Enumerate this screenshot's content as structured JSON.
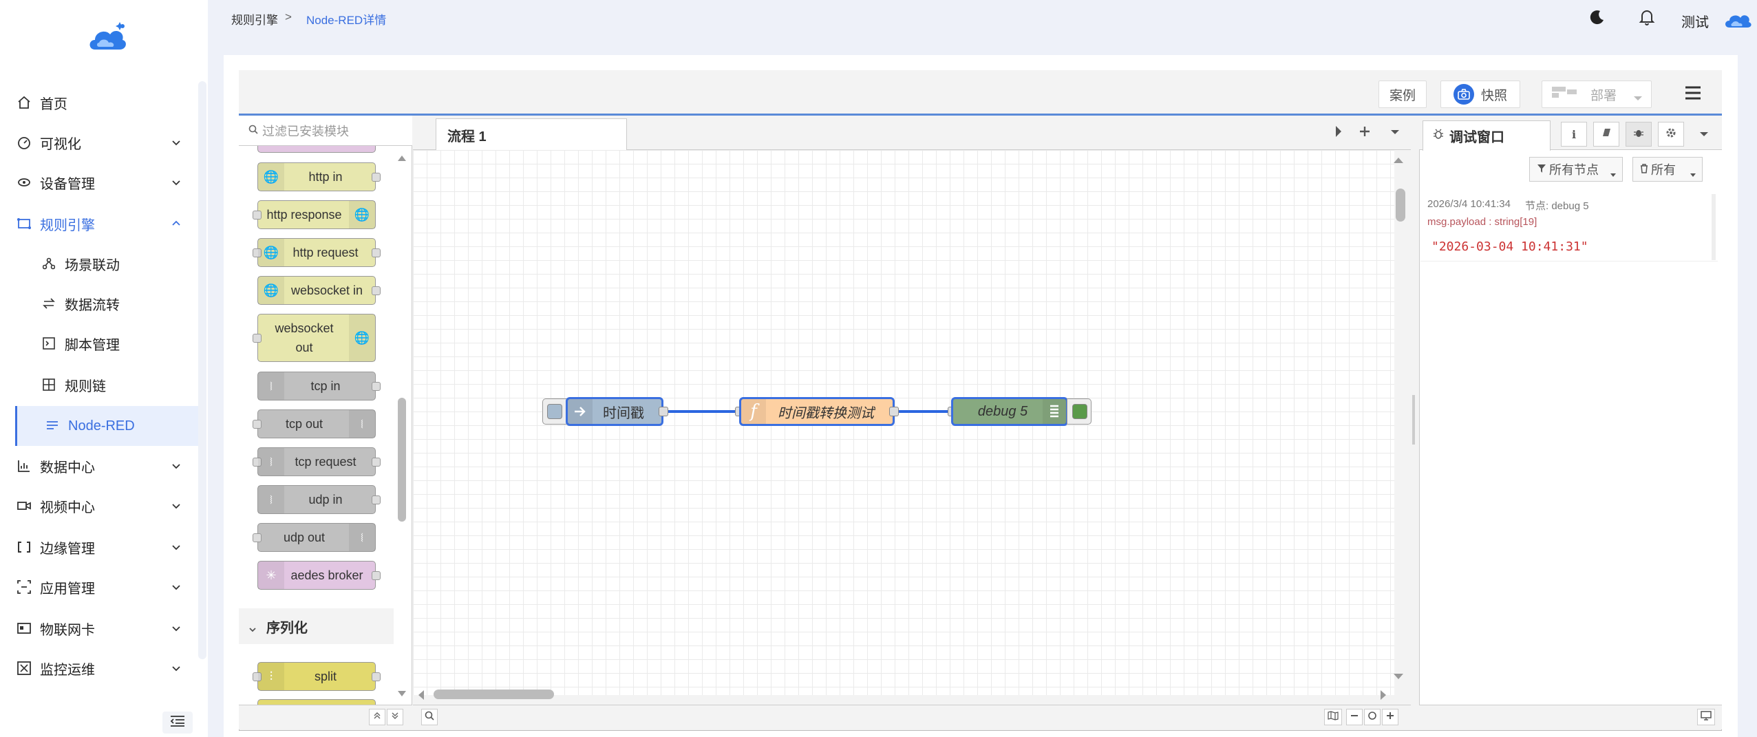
{
  "sidebar": {
    "items": [
      {
        "label": "首页",
        "icon": "home-icon"
      },
      {
        "label": "可视化",
        "icon": "dashboard-icon"
      },
      {
        "label": "设备管理",
        "icon": "device-icon"
      },
      {
        "label": "规则引擎",
        "icon": "rule-engine-icon"
      },
      {
        "label": "场景联动",
        "icon": "scene-icon"
      },
      {
        "label": "数据流转",
        "icon": "transfer-icon"
      },
      {
        "label": "脚本管理",
        "icon": "script-icon"
      },
      {
        "label": "规则链",
        "icon": "rule-chain-icon"
      },
      {
        "label": "Node-RED",
        "icon": "list-icon"
      },
      {
        "label": "数据中心",
        "icon": "chart-icon"
      },
      {
        "label": "视频中心",
        "icon": "video-icon"
      },
      {
        "label": "边缘管理",
        "icon": "edge-icon"
      },
      {
        "label": "应用管理",
        "icon": "app-icon"
      },
      {
        "label": "物联网卡",
        "icon": "card-icon"
      },
      {
        "label": "监控运维",
        "icon": "monitor-icon"
      }
    ]
  },
  "header": {
    "breadcrumb": [
      "规则引擎",
      "Node-RED详情"
    ],
    "separator": ">",
    "user": "测试"
  },
  "nodered": {
    "toolbar": {
      "cases": "案例",
      "snapshot": "快照",
      "deploy": "部署"
    },
    "palette": {
      "search_placeholder": "过滤已安装模块",
      "nodes": [
        "http in",
        "http response",
        "http request",
        "websocket in",
        "websocket out",
        "tcp in",
        "tcp out",
        "tcp request",
        "udp in",
        "udp out",
        "aedes broker"
      ],
      "websocket_out_lines": [
        "websocket",
        "out"
      ],
      "category": "序列化",
      "category_nodes": [
        "split"
      ]
    },
    "workspace": {
      "tab": "流程 1",
      "nodes": [
        {
          "label": "时间戳",
          "type": "inject"
        },
        {
          "label": "时间戳转换测试",
          "type": "function"
        },
        {
          "label": "debug 5",
          "type": "debug"
        }
      ]
    },
    "debug": {
      "title": "调试窗口",
      "filter_nodes": "所有节点",
      "filter_all": "所有",
      "message": {
        "timestamp": "2026/3/4 10:41:34",
        "node": "节点: debug 5",
        "path": "msg.payload : string[19]",
        "value": "\"2026-03-04 10:41:31\""
      }
    }
  },
  "colors": {
    "accent": "#3a6fe0",
    "inject": "#a6bbcf",
    "function": "#fdd0a2",
    "debug": "#87a980"
  }
}
